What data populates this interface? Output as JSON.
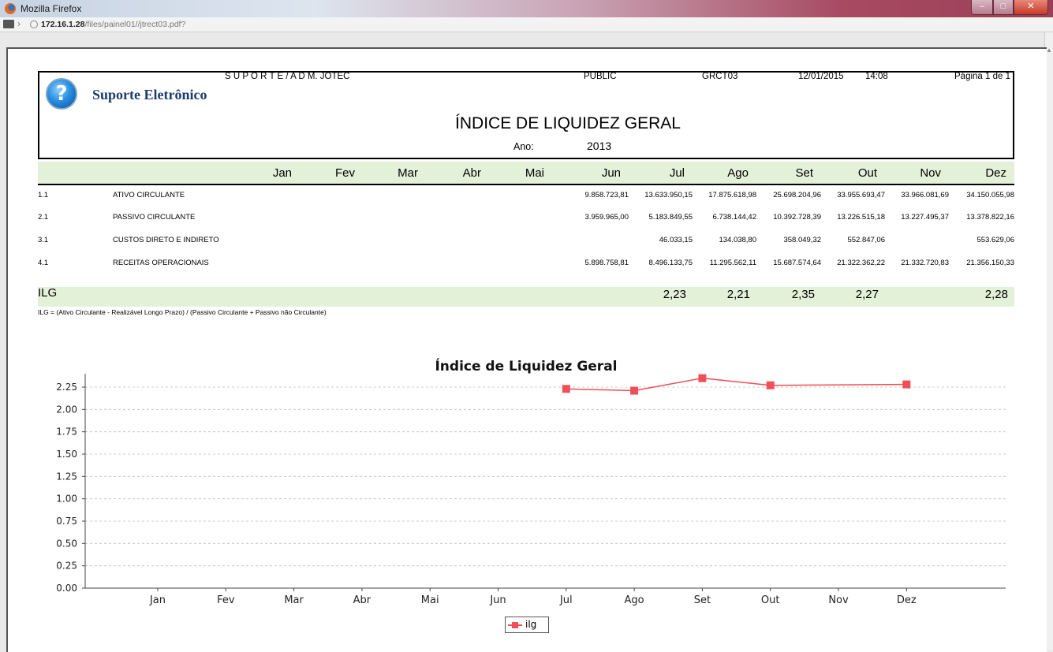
{
  "window": {
    "title": "Mozilla Firefox"
  },
  "address": {
    "host": "172.16.1.28",
    "path": "/files/painel01//jtrect03.pdf?"
  },
  "report": {
    "org": "S U P O R T E /  A D M. JOTEC",
    "brand": "Suporte Eletrônico",
    "schema": "PUBLIC",
    "code": "GRCT03",
    "date": "12/01/2015",
    "time": "14:08",
    "page": "Página 1 de   1",
    "title": "ÍNDICE DE LIQUIDEZ GERAL",
    "year_label": "Ano:",
    "year": "2013"
  },
  "table": {
    "months": [
      "Jan",
      "Fev",
      "Mar",
      "Abr",
      "Mai",
      "Jun",
      "Jul",
      "Ago",
      "Set",
      "Out",
      "Nov",
      "Dez"
    ],
    "rows": [
      {
        "code": "1.1",
        "name": "ATIVO CIRCULANTE",
        "values": [
          "",
          "",
          "",
          "",
          "",
          "9.858.723,81",
          "13.633.950,15",
          "17.875.618,98",
          "25.698.204,96",
          "33.955.693,47",
          "33.966.081,69",
          "34.150.055,98"
        ]
      },
      {
        "code": "2.1",
        "name": "PASSIVO CIRCULANTE",
        "values": [
          "",
          "",
          "",
          "",
          "",
          "3.959.965,00",
          "5.183.849,55",
          "6.738.144,42",
          "10.392.728,39",
          "13.226.515,18",
          "13.227.495,37",
          "13.378.822,16"
        ]
      },
      {
        "code": "3.1",
        "name": "CUSTOS DIRETO E INDIRETO",
        "values": [
          "",
          "",
          "",
          "",
          "",
          "",
          "46.033,15",
          "134.038,80",
          "358.049,32",
          "552.847,06",
          "",
          "553.629,06"
        ]
      },
      {
        "code": "4.1",
        "name": "RECEITAS OPERACIONAIS",
        "values": [
          "",
          "",
          "",
          "",
          "",
          "5.898.758,81",
          "8.496.133,75",
          "11.295.562,11",
          "15.687.574,64",
          "21.322.362,22",
          "21.332.720,83",
          "21.356.150,33"
        ]
      }
    ],
    "ilg_label": "ILG",
    "ilg_values": [
      "",
      "",
      "",
      "",
      "",
      "",
      "2,23",
      "2,21",
      "2,35",
      "2,27",
      "",
      "2,28"
    ],
    "formula": "ILG = (Ativo Circulante - Realizável Longo Prazo) / (Passivo Circulante + Passivo não Circulante)"
  },
  "colors": {
    "band": "#e4f1d9",
    "series": "#ef4f57"
  },
  "chart_data": {
    "type": "line",
    "title": "Índice de Liquidez Geral",
    "categories": [
      "Jan",
      "Fev",
      "Mar",
      "Abr",
      "Mai",
      "Jun",
      "Jul",
      "Ago",
      "Set",
      "Out",
      "Nov",
      "Dez"
    ],
    "series": [
      {
        "name": "ilg",
        "values": [
          null,
          null,
          null,
          null,
          null,
          null,
          2.23,
          2.21,
          2.35,
          2.27,
          null,
          2.28
        ]
      }
    ],
    "ylim": [
      0,
      2.4
    ],
    "yticks": [
      "0.00",
      "0.25",
      "0.50",
      "0.75",
      "1.00",
      "1.25",
      "1.50",
      "1.75",
      "2.00",
      "2.25"
    ],
    "grid": true,
    "legend": "bottom-center"
  }
}
